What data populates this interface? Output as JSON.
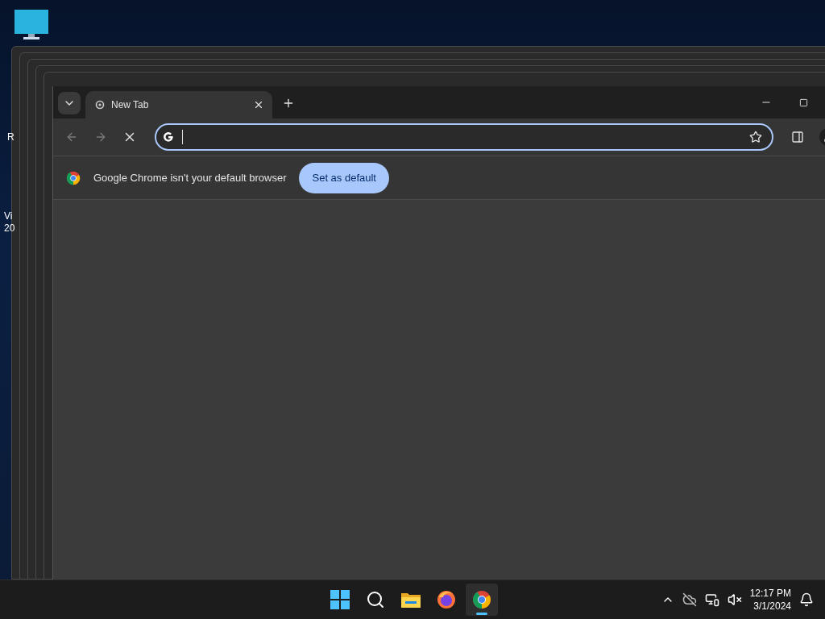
{
  "desktop": {
    "icon_labels": [
      "R",
      "Vi",
      "20"
    ]
  },
  "browser": {
    "tabs": [
      {
        "title": "New Tab",
        "selected": true
      }
    ],
    "nav": [
      {
        "kind": "back",
        "disabled": true
      },
      {
        "kind": "forward",
        "disabled": true
      },
      {
        "kind": "stop",
        "disabled": false
      }
    ],
    "infobar": {
      "message": "Google Chrome isn't your default browser",
      "button": "Set as default"
    }
  },
  "taskbar": {
    "apps": [
      {
        "kind": "start",
        "selected": false
      },
      {
        "kind": "search",
        "selected": false
      },
      {
        "kind": "files",
        "selected": false
      },
      {
        "kind": "firefox",
        "selected": false
      },
      {
        "kind": "chrome",
        "selected": true
      }
    ],
    "clock": {
      "time": "12:17 PM",
      "date": "3/1/2024"
    }
  }
}
